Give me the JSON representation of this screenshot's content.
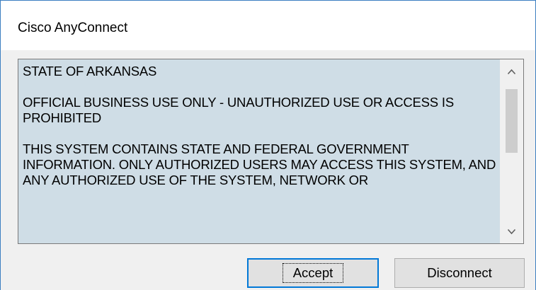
{
  "window": {
    "title": "Cisco AnyConnect"
  },
  "banner": {
    "paragraphs": [
      "STATE OF ARKANSAS",
      "OFFICIAL BUSINESS USE ONLY - UNAUTHORIZED USE OR ACCESS IS PROHIBITED",
      "THIS SYSTEM CONTAINS STATE AND FEDERAL GOVERNMENT INFORMATION. ONLY AUTHORIZED USERS MAY ACCESS THIS SYSTEM, AND ANY AUTHORIZED USE OF THE SYSTEM, NETWORK OR"
    ]
  },
  "scrollbar": {
    "up_icon": "chevron-up-icon",
    "down_icon": "chevron-down-icon"
  },
  "buttons": {
    "accept": "Accept",
    "disconnect": "Disconnect"
  },
  "colors": {
    "textbox_background": "#cfdde6",
    "accept_focus_border": "#0078d7",
    "window_border": "#3c7fc1"
  }
}
